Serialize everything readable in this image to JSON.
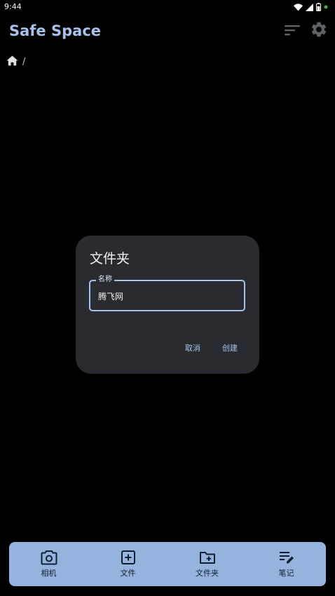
{
  "status_bar": {
    "time": "9:44",
    "icons": [
      "wifi-icon",
      "cellular-icon",
      "battery-icon",
      "privacy-dot-icon"
    ],
    "privacy_dot_color": "#4caf50"
  },
  "app_bar": {
    "title": "Safe Space",
    "actions": [
      "sort-icon",
      "settings-icon"
    ]
  },
  "breadcrumb": {
    "home_icon": "home-icon",
    "separator": "/"
  },
  "dialog": {
    "title": "文件夹",
    "field_label": "名称",
    "field_value": "腾飞网",
    "cancel_label": "取消",
    "create_label": "创建"
  },
  "bottom_nav": {
    "items": [
      {
        "label": "相机",
        "icon": "camera-icon"
      },
      {
        "label": "文件",
        "icon": "add-box-icon"
      },
      {
        "label": "文件夹",
        "icon": "folder-add-icon"
      },
      {
        "label": "笔记",
        "icon": "edit-note-icon"
      }
    ]
  },
  "colors": {
    "background": "#000000",
    "accent": "#a9c1e8",
    "dialog_surface": "#292b30",
    "bottom_bar": "#95b3dc"
  }
}
